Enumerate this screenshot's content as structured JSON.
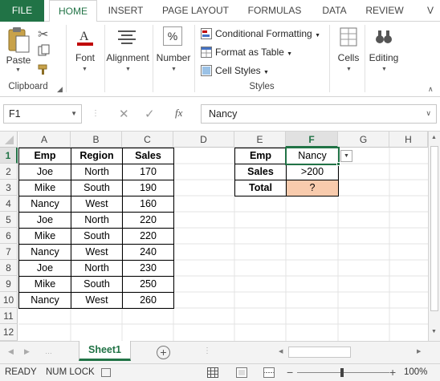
{
  "ribbon_tabs": [
    "FILE",
    "HOME",
    "INSERT",
    "PAGE LAYOUT",
    "FORMULAS",
    "DATA",
    "REVIEW",
    "V"
  ],
  "clipboard": {
    "paste": "Paste",
    "group": "Clipboard"
  },
  "font": {
    "label": "Font"
  },
  "alignment": {
    "label": "Alignment"
  },
  "number": {
    "label": "Number",
    "icon": "%"
  },
  "styles": {
    "conditional": "Conditional Formatting",
    "table": "Format as Table",
    "cell_styles": "Cell Styles",
    "group": "Styles"
  },
  "cells": {
    "label": "Cells"
  },
  "editing": {
    "label": "Editing"
  },
  "formula_bar": {
    "name_box": "F1",
    "value": "Nancy",
    "fx": "fx"
  },
  "columns": [
    "A",
    "B",
    "C",
    "D",
    "E",
    "F",
    "G",
    "H"
  ],
  "rows": [
    "1",
    "2",
    "3",
    "4",
    "5",
    "6",
    "7",
    "8",
    "9",
    "10",
    "11",
    "12"
  ],
  "table": {
    "headers": [
      "Emp",
      "Region",
      "Sales"
    ],
    "rows": [
      [
        "Joe",
        "North",
        "170"
      ],
      [
        "Mike",
        "South",
        "190"
      ],
      [
        "Nancy",
        "West",
        "160"
      ],
      [
        "Joe",
        "North",
        "220"
      ],
      [
        "Mike",
        "South",
        "220"
      ],
      [
        "Nancy",
        "West",
        "240"
      ],
      [
        "Joe",
        "North",
        "230"
      ],
      [
        "Mike",
        "South",
        "250"
      ],
      [
        "Nancy",
        "West",
        "260"
      ]
    ]
  },
  "criteria": {
    "emp_label": "Emp",
    "emp_value": "Nancy",
    "sales_label": "Sales",
    "sales_value": ">200",
    "total_label": "Total",
    "total_value": "?"
  },
  "sheet": {
    "name": "Sheet1"
  },
  "status": {
    "ready": "READY",
    "numlock": "NUM LOCK",
    "zoom": "100%"
  },
  "colors": {
    "accent": "#217346",
    "total_fill": "#f8cbad",
    "selected_header": "#e1e1e1"
  }
}
